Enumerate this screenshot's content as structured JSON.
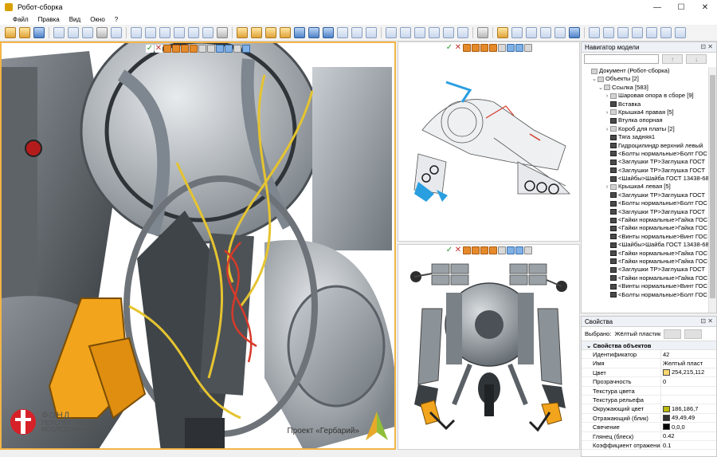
{
  "window": {
    "title": "Робот-сборка",
    "controls": [
      "—",
      "☐",
      "✕"
    ]
  },
  "menu": [
    "Файл",
    "Правка",
    "Вид",
    "Окно",
    "?"
  ],
  "viewport_main": {
    "project_label": "Проект «Гербарий»",
    "logo_lines": [
      "ФОНД",
      "ПЕРСПЕКТИВНЫХ",
      "ИССЛЕДОВАНИЙ"
    ]
  },
  "navigator": {
    "title": "Навигатор модели",
    "search_placeholder": "",
    "tree": [
      {
        "label": "Документ (Робот-сборка)",
        "level": 0,
        "twisty": "",
        "bold": false
      },
      {
        "label": "Объекты [2]",
        "level": 1,
        "twisty": "⌄",
        "bold": false
      },
      {
        "label": "Ссылка [583]",
        "level": 2,
        "twisty": "⌄",
        "bold": false
      },
      {
        "label": "Шаровая опора в сборе [9]",
        "level": 3,
        "twisty": "›",
        "bold": false
      },
      {
        "label": "Вставка",
        "level": 3,
        "twisty": "",
        "bold": true
      },
      {
        "label": "Крышка4 правая [5]",
        "level": 3,
        "twisty": "›",
        "bold": false
      },
      {
        "label": "Втулка опорная",
        "level": 3,
        "twisty": "",
        "bold": true
      },
      {
        "label": "Короб для платы [2]",
        "level": 3,
        "twisty": "›",
        "bold": false
      },
      {
        "label": "Тяга задняя1",
        "level": 3,
        "twisty": "",
        "bold": true
      },
      {
        "label": "Гидроцилиндр верхний левый",
        "level": 3,
        "twisty": "",
        "bold": true
      },
      {
        "label": "<Болты нормальные>Болт ГОС",
        "level": 3,
        "twisty": "",
        "bold": true
      },
      {
        "label": "<Заглушки ТР>Заглушка ГОСТ",
        "level": 3,
        "twisty": "",
        "bold": true
      },
      {
        "label": "<Заглушки ТР>Заглушка ГОСТ",
        "level": 3,
        "twisty": "",
        "bold": true
      },
      {
        "label": "<Шайбы>Шайба ГОСТ 13438-68",
        "level": 3,
        "twisty": "",
        "bold": true
      },
      {
        "label": "Крышка4 левая [5]",
        "level": 3,
        "twisty": "›",
        "bold": false
      },
      {
        "label": "<Заглушки ТР>Заглушка ГОСТ",
        "level": 3,
        "twisty": "",
        "bold": true
      },
      {
        "label": "<Болты нормальные>Болт ГОС",
        "level": 3,
        "twisty": "",
        "bold": true
      },
      {
        "label": "<Заглушки ТР>Заглушка ГОСТ",
        "level": 3,
        "twisty": "",
        "bold": true
      },
      {
        "label": "<Гайки нормальные>Гайка ГОС",
        "level": 3,
        "twisty": "",
        "bold": true
      },
      {
        "label": "<Гайки нормальные>Гайка ГОС",
        "level": 3,
        "twisty": "",
        "bold": true
      },
      {
        "label": "<Винты нормальные>Винт ГОС",
        "level": 3,
        "twisty": "",
        "bold": true
      },
      {
        "label": "<Шайбы>Шайба ГОСТ 13438-68",
        "level": 3,
        "twisty": "",
        "bold": true
      },
      {
        "label": "<Гайки нормальные>Гайка ГОС",
        "level": 3,
        "twisty": "",
        "bold": true
      },
      {
        "label": "<Гайки нормальные>Гайка ГОС",
        "level": 3,
        "twisty": "",
        "bold": true
      },
      {
        "label": "<Заглушки ТР>Заглушка ГОСТ",
        "level": 3,
        "twisty": "",
        "bold": true
      },
      {
        "label": "<Гайки нормальные>Гайка ГОС",
        "level": 3,
        "twisty": "",
        "bold": true
      },
      {
        "label": "<Винты нормальные>Винт ГОС",
        "level": 3,
        "twisty": "",
        "bold": true
      },
      {
        "label": "<Болты нормальные>Болт ГОС",
        "level": 3,
        "twisty": "",
        "bold": true
      }
    ]
  },
  "properties": {
    "title": "Свойства",
    "selected_label": "Выбрано:",
    "selected_value": "Жёлтый пластик",
    "group": "Свойства объектов",
    "rows": [
      {
        "key": "Идентификатор",
        "value": "42",
        "swatch": ""
      },
      {
        "key": "Имя",
        "value": "Желтый пласт",
        "swatch": ""
      },
      {
        "key": "Цвет",
        "value": "254,215,112",
        "swatch": "#fed770"
      },
      {
        "key": "Прозрачность",
        "value": "0",
        "swatch": ""
      },
      {
        "key": "Текстура цвета",
        "value": "",
        "swatch": ""
      },
      {
        "key": "Текстура рельефа",
        "value": "",
        "swatch": ""
      },
      {
        "key": "Окружающий цвет",
        "value": "186,186,7",
        "swatch": "#baba07"
      },
      {
        "key": "Отражающий (блик)",
        "value": "49,49,49",
        "swatch": "#313131"
      },
      {
        "key": "Свечение",
        "value": "0,0,0",
        "swatch": "#000000"
      },
      {
        "key": "Глянец (блеск)",
        "value": "0.42",
        "swatch": ""
      },
      {
        "key": "Коэффициент отражения",
        "value": "0.1",
        "swatch": ""
      }
    ]
  }
}
